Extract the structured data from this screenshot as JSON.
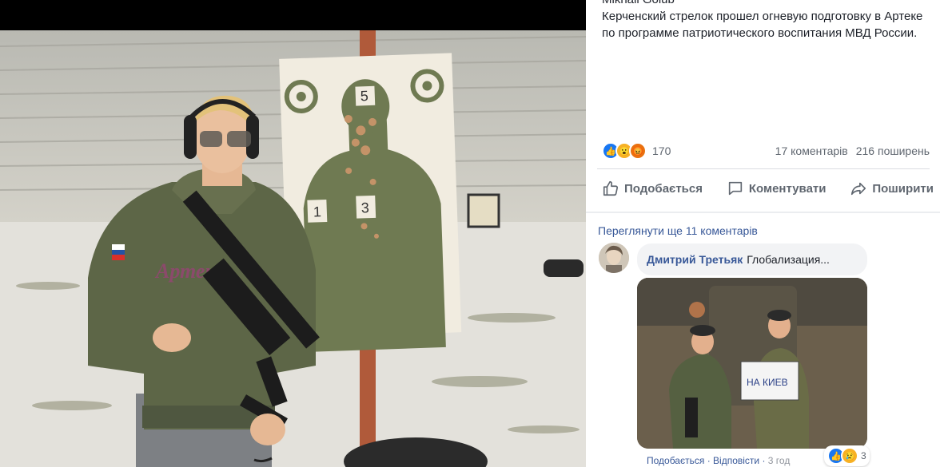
{
  "post": {
    "author": "Mikhail Golub",
    "caption": "Керченский стрелок прошел огневую подготовку в Артеке по программе патриотического воспитания МВД России.",
    "photo": {
      "target_numbers": [
        "5",
        "1",
        "3"
      ],
      "sweatshirt_text": "Артек"
    }
  },
  "stats": {
    "reaction_icons": [
      "like-icon",
      "wow-icon",
      "angry-icon"
    ],
    "reactions_count": "170",
    "comments": "17 коментарів",
    "shares": "216 поширень"
  },
  "actions": {
    "like": "Подобається",
    "comment": "Коментувати",
    "share": "Поширити"
  },
  "comments_section": {
    "view_more": "Переглянути ще 11 коментарів",
    "comment": {
      "name": "Дмитрий Третьяк",
      "text": "Глобализация...",
      "sign_text": "НА КИЕВ",
      "footer": {
        "like": "Подобається",
        "sep1": " · ",
        "reply": "Відповісти",
        "sep2": " · ",
        "time": "3 год"
      },
      "reaction_icons": [
        "like-icon",
        "sad-icon"
      ],
      "reactions_count": "3"
    }
  },
  "colors": {
    "link": "#385898",
    "text": "#1d2129",
    "meta": "#606770",
    "like": "#1877f2"
  }
}
